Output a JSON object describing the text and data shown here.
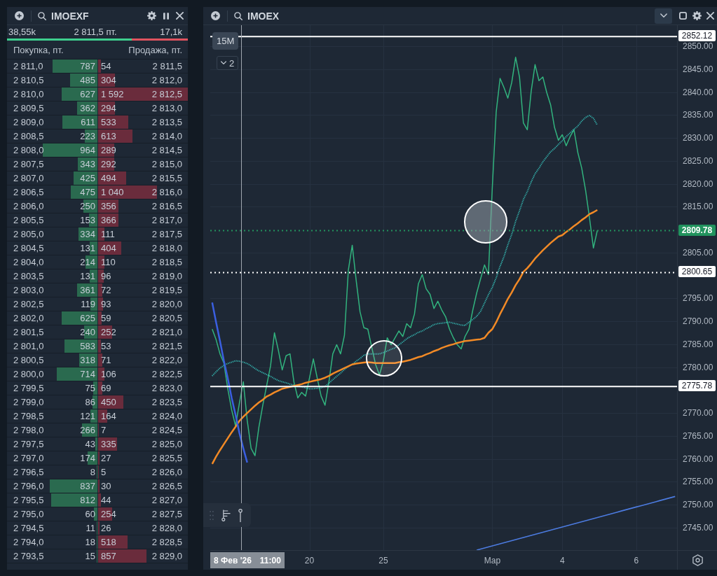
{
  "order_book": {
    "symbol": "IMOEXF",
    "summary": {
      "buy_volume": "38,55k",
      "price": "2 811,5 пт.",
      "sell_volume": "17,1k"
    },
    "balance": {
      "level": 0.69
    },
    "columns": [
      "Покупка, пт.",
      "Продажа, пт."
    ],
    "rows": [
      {
        "bid": {
          "price": "2 811,0",
          "volume": "787",
          "level": 0.494
        },
        "ask": {
          "volume": "54",
          "price": "2 811,5",
          "level": 0.034
        }
      },
      {
        "bid": {
          "price": "2 810,5",
          "volume": "485",
          "level": 0.305
        },
        "ask": {
          "volume": "304",
          "price": "2 812,0",
          "level": 0.191
        }
      },
      {
        "bid": {
          "price": "2 810,0",
          "volume": "627",
          "level": 0.394
        },
        "ask": {
          "volume": "1 592",
          "price": "2 812,5",
          "level": 1.0
        }
      },
      {
        "bid": {
          "price": "2 809,5",
          "volume": "362",
          "level": 0.227
        },
        "ask": {
          "volume": "294",
          "price": "2 813,0",
          "level": 0.185
        }
      },
      {
        "bid": {
          "price": "2 809,0",
          "volume": "611",
          "level": 0.384
        },
        "ask": {
          "volume": "533",
          "price": "2 813,5",
          "level": 0.335
        }
      },
      {
        "bid": {
          "price": "2 808,5",
          "volume": "223",
          "level": 0.14
        },
        "ask": {
          "volume": "613",
          "price": "2 814,0",
          "level": 0.385
        }
      },
      {
        "bid": {
          "price": "2 808,0",
          "volume": "964",
          "level": 0.606
        },
        "ask": {
          "volume": "289",
          "price": "2 814,5",
          "level": 0.182
        }
      },
      {
        "bid": {
          "price": "2 807,5",
          "volume": "343",
          "level": 0.215
        },
        "ask": {
          "volume": "292",
          "price": "2 815,0",
          "level": 0.183
        }
      },
      {
        "bid": {
          "price": "2 807,0",
          "volume": "425",
          "level": 0.267
        },
        "ask": {
          "volume": "494",
          "price": "2 815,5",
          "level": 0.31
        }
      },
      {
        "bid": {
          "price": "2 806,5",
          "volume": "475",
          "level": 0.298
        },
        "ask": {
          "volume": "1 040",
          "price": "2 816,0",
          "level": 0.653
        }
      },
      {
        "bid": {
          "price": "2 806,0",
          "volume": "250",
          "level": 0.157
        },
        "ask": {
          "volume": "356",
          "price": "2 816,5",
          "level": 0.224
        }
      },
      {
        "bid": {
          "price": "2 805,5",
          "volume": "153",
          "level": 0.096
        },
        "ask": {
          "volume": "366",
          "price": "2 817,0",
          "level": 0.23
        }
      },
      {
        "bid": {
          "price": "2 805,0",
          "volume": "334",
          "level": 0.21
        },
        "ask": {
          "volume": "111",
          "price": "2 817,5",
          "level": 0.07
        }
      },
      {
        "bid": {
          "price": "2 804,5",
          "volume": "131",
          "level": 0.082
        },
        "ask": {
          "volume": "404",
          "price": "2 818,0",
          "level": 0.254
        }
      },
      {
        "bid": {
          "price": "2 804,0",
          "volume": "214",
          "level": 0.134
        },
        "ask": {
          "volume": "110",
          "price": "2 818,5",
          "level": 0.069
        }
      },
      {
        "bid": {
          "price": "2 803,5",
          "volume": "131",
          "level": 0.082
        },
        "ask": {
          "volume": "96",
          "price": "2 819,0",
          "level": 0.06
        }
      },
      {
        "bid": {
          "price": "2 803,0",
          "volume": "361",
          "level": 0.227
        },
        "ask": {
          "volume": "72",
          "price": "2 819,5",
          "level": 0.045
        }
      },
      {
        "bid": {
          "price": "2 802,5",
          "volume": "119",
          "level": 0.075
        },
        "ask": {
          "volume": "93",
          "price": "2 820,0",
          "level": 0.058
        }
      },
      {
        "bid": {
          "price": "2 802,0",
          "volume": "625",
          "level": 0.393
        },
        "ask": {
          "volume": "59",
          "price": "2 820,5",
          "level": 0.037
        }
      },
      {
        "bid": {
          "price": "2 801,5",
          "volume": "240",
          "level": 0.151
        },
        "ask": {
          "volume": "252",
          "price": "2 821,0",
          "level": 0.158
        }
      },
      {
        "bid": {
          "price": "2 801,0",
          "volume": "583",
          "level": 0.366
        },
        "ask": {
          "volume": "53",
          "price": "2 821,5",
          "level": 0.033
        }
      },
      {
        "bid": {
          "price": "2 800,5",
          "volume": "318",
          "level": 0.2
        },
        "ask": {
          "volume": "71",
          "price": "2 822,0",
          "level": 0.045
        }
      },
      {
        "bid": {
          "price": "2 800,0",
          "volume": "714",
          "level": 0.448
        },
        "ask": {
          "volume": "106",
          "price": "2 822,5",
          "level": 0.067
        }
      },
      {
        "bid": {
          "price": "2 799,5",
          "volume": "75",
          "level": 0.047
        },
        "ask": {
          "volume": "69",
          "price": "2 823,0",
          "level": 0.043
        }
      },
      {
        "bid": {
          "price": "2 799,0",
          "volume": "86",
          "level": 0.054
        },
        "ask": {
          "volume": "450",
          "price": "2 823,5",
          "level": 0.283
        }
      },
      {
        "bid": {
          "price": "2 798,5",
          "volume": "121",
          "level": 0.076
        },
        "ask": {
          "volume": "164",
          "price": "2 824,0",
          "level": 0.103
        }
      },
      {
        "bid": {
          "price": "2 798,0",
          "volume": "266",
          "level": 0.167
        },
        "ask": {
          "volume": "7",
          "price": "2 824,5",
          "level": 0.004
        }
      },
      {
        "bid": {
          "price": "2 797,5",
          "volume": "43",
          "level": 0.027
        },
        "ask": {
          "volume": "335",
          "price": "2 825,0",
          "level": 0.21
        }
      },
      {
        "bid": {
          "price": "2 797,0",
          "volume": "174",
          "level": 0.109
        },
        "ask": {
          "volume": "27",
          "price": "2 825,5",
          "level": 0.017
        }
      },
      {
        "bid": {
          "price": "2 796,5",
          "volume": "8",
          "level": 0.005
        },
        "ask": {
          "volume": "5",
          "price": "2 826,0",
          "level": 0.003
        }
      },
      {
        "bid": {
          "price": "2 796,0",
          "volume": "837",
          "level": 0.526
        },
        "ask": {
          "volume": "30",
          "price": "2 826,5",
          "level": 0.019
        }
      },
      {
        "bid": {
          "price": "2 795,5",
          "volume": "812",
          "level": 0.51
        },
        "ask": {
          "volume": "44",
          "price": "2 827,0",
          "level": 0.028
        }
      },
      {
        "bid": {
          "price": "2 795,0",
          "volume": "60",
          "level": 0.038
        },
        "ask": {
          "volume": "254",
          "price": "2 827,5",
          "level": 0.16
        }
      },
      {
        "bid": {
          "price": "2 794,5",
          "volume": "11",
          "level": 0.007
        },
        "ask": {
          "volume": "26",
          "price": "2 828,0",
          "level": 0.016
        }
      },
      {
        "bid": {
          "price": "2 794,0",
          "volume": "18",
          "level": 0.011
        },
        "ask": {
          "volume": "518",
          "price": "2 828,5",
          "level": 0.325
        }
      },
      {
        "bid": {
          "price": "2 793,5",
          "volume": "15",
          "level": 0.009
        },
        "ask": {
          "volume": "857",
          "price": "2 829,0",
          "level": 0.538
        }
      }
    ]
  },
  "chart": {
    "symbol": "IMOEX",
    "interval": "15M",
    "panes": "2",
    "crosshair": {
      "date": "8 Фев '26",
      "time": "11:00"
    },
    "chart_data": {
      "type": "line",
      "grid": true,
      "categories": [
        null,
        null,
        null,
        null,
        null,
        null,
        null,
        null,
        null,
        null,
        null,
        null,
        null,
        null,
        null,
        null,
        null,
        null,
        null,
        null,
        null,
        null,
        null,
        null,
        null,
        "20",
        null,
        null,
        null,
        null,
        null,
        null,
        null,
        null,
        null,
        null,
        null,
        null,
        null,
        null,
        null,
        null,
        null,
        null,
        "25",
        null,
        null,
        null,
        null,
        null,
        null,
        null,
        null,
        null,
        null,
        null,
        null,
        null,
        null,
        null,
        null,
        null,
        null,
        null,
        null,
        null,
        null,
        null,
        null,
        null,
        null,
        null,
        "Мар",
        null,
        null,
        null,
        null,
        null,
        null,
        null,
        null,
        null,
        null,
        null,
        null,
        null,
        null,
        null,
        null,
        null,
        "4",
        null,
        null,
        null,
        null,
        null,
        null,
        null,
        null,
        null,
        null,
        null,
        null,
        null,
        null,
        null,
        null,
        null,
        null,
        "6",
        null,
        null,
        null,
        null,
        null,
        null,
        null,
        null,
        null,
        null
      ],
      "ylim": [
        2740.1,
        2854.6
      ],
      "yticks": [
        {
          "value": 2850,
          "label": "2850.00"
        },
        {
          "value": 2845,
          "label": "2845.00"
        },
        {
          "value": 2840,
          "label": "2840.00"
        },
        {
          "value": 2835,
          "label": "2835.00"
        },
        {
          "value": 2830,
          "label": "2830.00"
        },
        {
          "value": 2825,
          "label": "2825.00"
        },
        {
          "value": 2820,
          "label": "2820.00"
        },
        {
          "value": 2815,
          "label": "2815.00"
        },
        {
          "value": 2805,
          "label": "2805.00"
        },
        {
          "value": 2795,
          "label": "2795.00"
        },
        {
          "value": 2790,
          "label": "2790.00"
        },
        {
          "value": 2785,
          "label": "2785.00"
        },
        {
          "value": 2780,
          "label": "2780.00"
        },
        {
          "value": 2770,
          "label": "2770.00"
        },
        {
          "value": 2765,
          "label": "2765.00"
        },
        {
          "value": 2760,
          "label": "2760.00"
        },
        {
          "value": 2755,
          "label": "2755.00"
        },
        {
          "value": 2750,
          "label": "2750.00"
        },
        {
          "value": 2745,
          "label": "2745.00"
        }
      ],
      "series": [
        {
          "color": "#32b37e",
          "line_style": "solid",
          "values": [
            2788.3,
            2786.0,
            2782.9,
            2780.9,
            2775.3,
            2770.7,
            2767.2,
            2772.2,
            2776.8,
            2768.4,
            2762.3,
            2760.7,
            2766.9,
            2771.7,
            2776.0,
            2780.3,
            2787.5,
            2783.7,
            2779.4,
            2782.5,
            2782.9,
            2776.8,
            2773.3,
            2774.5,
            2773.7,
            2777.6,
            2781.8,
            2777.6,
            2773.7,
            2771.7,
            2776.8,
            2782.9,
            2784.9,
            2782.9,
            2787.0,
            2801.2,
            2806.6,
            2799.0,
            2792.1,
            2788.6,
            2788.3,
            2784.4,
            2780.6,
            2778.3,
            2781.4,
            2786.4,
            2784.9,
            2786.4,
            2787.9,
            2786.7,
            2789.5,
            2788.6,
            2791.6,
            2798.2,
            2800.2,
            2797.1,
            2795.9,
            2792.8,
            2794.4,
            2792.5,
            2791.0,
            2788.3,
            2786.4,
            2784.9,
            2784.0,
            2786.7,
            2788.3,
            2792.5,
            2796.2,
            2799.3,
            2802.3,
            2800.2,
            2819.1,
            2835.6,
            2843.0,
            2841.0,
            2838.7,
            2842.1,
            2847.6,
            2843.3,
            2833.3,
            2831.8,
            2840.2,
            2846.0,
            2842.5,
            2843.3,
            2839.9,
            2837.2,
            2832.3,
            2829.5,
            2830.7,
            2828.3,
            2830.3,
            2831.8,
            2826.8,
            2823.4,
            2818.5,
            2812.5,
            2806.0,
            2809.8,
            null,
            null,
            null,
            null,
            null,
            null,
            null,
            null,
            null,
            null,
            null,
            null,
            null,
            null,
            null,
            null,
            null,
            null,
            null,
            null
          ]
        },
        {
          "color": "#35b5b0",
          "line_style": "dotted",
          "values": [
            2778.1,
            2779.0,
            2779.8,
            2780.4,
            2780.8,
            2781.1,
            2781.4,
            2781.3,
            2781.1,
            2780.8,
            2780.3,
            2779.7,
            2779.2,
            2778.8,
            2778.4,
            2778.0,
            2777.5,
            2777.1,
            2776.8,
            2776.6,
            2776.3,
            2776.1,
            2775.9,
            2775.7,
            2775.5,
            2775.3,
            2775.3,
            2775.4,
            2775.5,
            2775.8,
            2776.5,
            2777.3,
            2778.0,
            2778.7,
            2779.5,
            2780.2,
            2780.6,
            2781.3,
            2781.9,
            2782.6,
            2782.9,
            2782.9,
            2782.9,
            2782.9,
            2783.2,
            2783.5,
            2783.9,
            2784.2,
            2784.9,
            2785.5,
            2786.2,
            2786.7,
            2787.1,
            2787.6,
            2787.9,
            2788.4,
            2788.8,
            2789.3,
            2789.5,
            2789.6,
            2789.7,
            2789.8,
            2789.6,
            2789.4,
            2789.2,
            2789.1,
            2789.8,
            2790.4,
            2791.1,
            2792.2,
            2794.0,
            2795.8,
            2797.4,
            2799.5,
            2802.0,
            2804.1,
            2806.7,
            2809.0,
            2811.8,
            2814.1,
            2816.6,
            2818.3,
            2820.4,
            2822.2,
            2823.4,
            2824.8,
            2825.9,
            2827.0,
            2827.7,
            2828.6,
            2829.4,
            2830.3,
            2831.1,
            2831.9,
            2832.6,
            2833.7,
            2834.5,
            2834.9,
            2834.3,
            2832.8,
            null,
            null,
            null,
            null,
            null,
            null,
            null,
            null,
            null,
            null,
            null,
            null,
            null,
            null,
            null,
            null,
            null,
            null,
            null,
            null
          ]
        },
        {
          "color": "#f28a26",
          "line_style": "solid",
          "values": [
            2758.9,
            2760.5,
            2761.9,
            2763.2,
            2764.5,
            2765.8,
            2767.0,
            2768.3,
            2769.2,
            2770.0,
            2770.8,
            2771.6,
            2772.3,
            2772.9,
            2773.6,
            2774.0,
            2774.5,
            2774.9,
            2775.3,
            2775.5,
            2775.7,
            2775.9,
            2776.1,
            2776.3,
            2776.6,
            2776.8,
            2777.0,
            2777.2,
            2777.4,
            2777.7,
            2778.1,
            2778.6,
            2779.0,
            2779.4,
            2779.8,
            2780.2,
            2780.6,
            2780.8,
            2780.9,
            2781.0,
            2781.1,
            2781.0,
            2780.9,
            2780.9,
            2780.9,
            2780.9,
            2780.9,
            2780.9,
            2781.1,
            2781.2,
            2781.4,
            2781.6,
            2781.9,
            2782.2,
            2782.4,
            2782.8,
            2783.1,
            2783.5,
            2783.8,
            2784.2,
            2784.5,
            2784.8,
            2785.0,
            2785.3,
            2785.5,
            2785.7,
            2785.8,
            2785.9,
            2786.0,
            2786.1,
            2786.4,
            2787.5,
            2788.3,
            2789.8,
            2791.6,
            2793.2,
            2794.9,
            2796.3,
            2797.9,
            2799.2,
            2800.8,
            2801.6,
            2802.6,
            2803.7,
            2804.6,
            2805.5,
            2806.3,
            2807.1,
            2807.8,
            2808.5,
            2808.8,
            2809.5,
            2810.1,
            2810.8,
            2811.4,
            2812.1,
            2812.7,
            2813.4,
            2813.8,
            2814.3,
            null,
            null,
            null,
            null,
            null,
            null,
            null,
            null,
            null,
            null,
            null,
            null,
            null,
            null,
            null,
            null,
            null,
            null,
            null,
            null
          ]
        },
        {
          "color": "#3a5fe0",
          "line_style": "solid",
          "values": [
            2794.1,
            2789.8,
            2785.7,
            2781.4,
            2777.6,
            2773.3,
            2769.6,
            2765.6,
            2762.3,
            2759.2,
            null,
            null,
            null,
            null,
            null,
            null,
            null,
            null,
            null,
            null,
            null,
            null,
            null,
            null,
            null,
            null,
            null,
            null,
            null,
            null,
            null,
            null,
            null,
            null,
            null,
            null,
            null,
            null,
            null,
            null,
            null,
            null,
            null,
            null,
            null,
            null,
            null,
            null,
            null,
            null,
            null,
            null,
            null,
            null,
            null,
            null,
            null,
            null,
            null,
            null,
            null,
            null,
            null,
            null,
            null,
            null,
            null,
            null,
            null,
            null,
            null,
            null,
            null,
            null,
            null,
            null,
            null,
            null,
            null,
            null,
            null,
            null,
            null,
            null,
            null,
            null,
            null,
            null,
            null,
            null,
            null,
            null,
            null,
            null,
            null,
            null,
            null,
            null,
            null,
            null,
            null,
            null,
            null,
            null,
            null,
            null,
            null,
            null,
            null,
            null,
            null,
            null,
            null,
            null,
            null,
            null,
            null,
            null,
            null,
            null
          ]
        },
        {
          "color": "#4c7be0",
          "line_style": "solid",
          "values": [
            null,
            null,
            null,
            null,
            null,
            null,
            null,
            null,
            null,
            null,
            null,
            null,
            null,
            null,
            null,
            null,
            null,
            null,
            null,
            null,
            null,
            null,
            null,
            null,
            null,
            null,
            null,
            null,
            null,
            null,
            null,
            null,
            null,
            null,
            null,
            null,
            null,
            null,
            null,
            null,
            null,
            null,
            null,
            null,
            null,
            null,
            null,
            null,
            null,
            null,
            null,
            null,
            null,
            null,
            null,
            null,
            null,
            null,
            null,
            null,
            null,
            null,
            null,
            null,
            null,
            null,
            null,
            null,
            2740.1,
            2740.33,
            2740.56,
            2740.79,
            2741.02,
            2741.25,
            2741.48,
            2741.71,
            2741.94,
            2742.16,
            2742.39,
            2742.62,
            2742.85,
            2743.08,
            2743.31,
            2743.54,
            2743.77,
            2744.0,
            2744.23,
            2744.46,
            2744.69,
            2744.92,
            2745.15,
            2745.38,
            2745.61,
            2745.84,
            2746.06,
            2746.29,
            2746.52,
            2746.75,
            2746.98,
            2747.21,
            2747.44,
            2747.67,
            2747.9,
            2748.13,
            2748.36,
            2748.59,
            2748.82,
            2749.05,
            2749.28,
            2749.51,
            2749.73,
            2749.96,
            2750.19,
            2750.42,
            2750.65,
            2750.88,
            2751.11,
            2751.34,
            2751.57,
            2751.8
          ]
        }
      ],
      "ref_lines": [
        {
          "axis": "y",
          "value": 2852.12,
          "label": "2852.12",
          "color": "#ffffff",
          "line_style": "solid"
        },
        {
          "axis": "y",
          "value": 2809.78,
          "label": "2809.78",
          "color": "#22935e",
          "line_style": "dotted"
        },
        {
          "axis": "y",
          "value": 2800.65,
          "label": "2800.65",
          "color": "#ffffff",
          "line_style": "dotted"
        },
        {
          "axis": "y",
          "value": 2775.78,
          "label": "2775.78",
          "color": "#ffffff",
          "line_style": "solid"
        }
      ]
    }
  }
}
